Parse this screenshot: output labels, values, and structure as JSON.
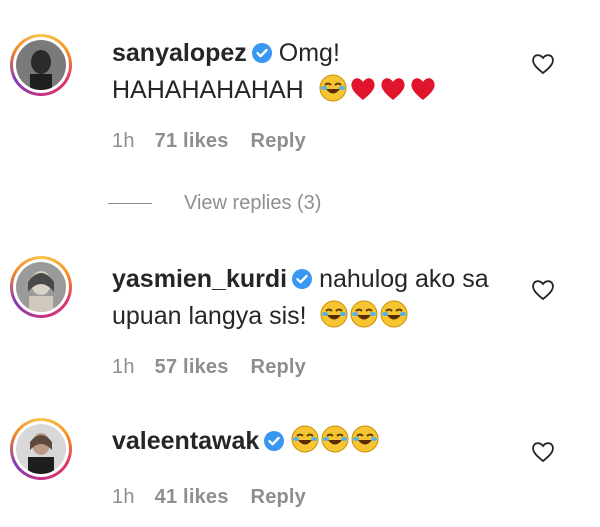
{
  "comments": [
    {
      "username": "sanyalopez",
      "text_line1": "Omg!",
      "text_line2": "HAHAHAHAHAH",
      "emojis": [
        "joy-emoji",
        "heart-emoji",
        "heart-emoji",
        "heart-emoji"
      ],
      "time": "1h",
      "likes": "71 likes",
      "reply": "Reply"
    },
    {
      "username": "yasmien_kurdi",
      "text_line1": "nahulog ako sa",
      "text_line2": "upuan langya sis!",
      "emojis": [
        "joy-emoji",
        "joy-emoji",
        "joy-emoji"
      ],
      "time": "1h",
      "likes": "57 likes",
      "reply": "Reply"
    },
    {
      "username": "valeentawak",
      "text_line1": "",
      "text_line2": "",
      "emojis": [
        "joy-emoji",
        "joy-emoji",
        "joy-emoji"
      ],
      "time": "1h",
      "likes": "41 likes",
      "reply": "Reply"
    }
  ],
  "view_replies": "View replies (3)",
  "colors": {
    "text": "#262626",
    "meta": "#8e8e8e",
    "verified": "#3897f0",
    "heart": "#e0152b"
  }
}
